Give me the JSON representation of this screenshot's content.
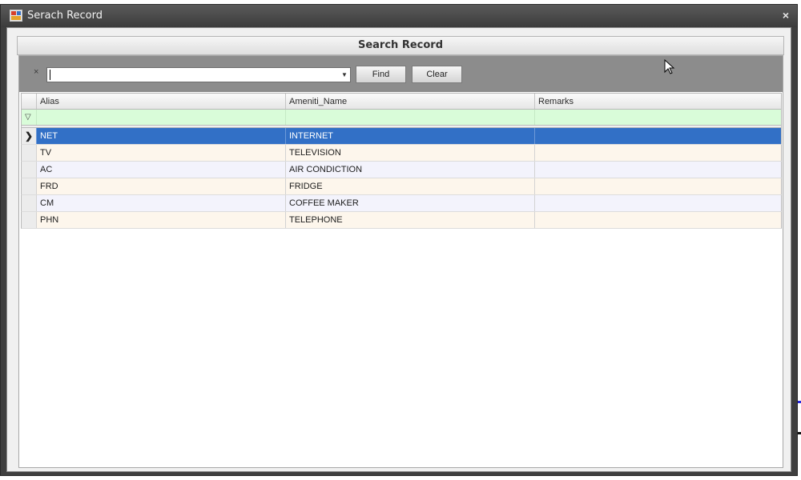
{
  "window": {
    "title": "Serach Record",
    "close_glyph": "×",
    "icon": "form-app-icon"
  },
  "group": {
    "header": "Search Record"
  },
  "find_panel": {
    "clear_glyph": "×",
    "search_value": "",
    "dropdown_glyph": "▼",
    "find_label": "Find",
    "clear_label": "Clear"
  },
  "grid": {
    "columns": [
      "Alias",
      "Ameniti_Name",
      "Remarks"
    ],
    "filter_icon": "▽",
    "row_indicator": "❯",
    "rows": [
      {
        "alias": "NET",
        "name": "INTERNET",
        "remarks": ""
      },
      {
        "alias": "TV",
        "name": "TELEVISION",
        "remarks": ""
      },
      {
        "alias": "AC",
        "name": "AIR CONDICTION",
        "remarks": ""
      },
      {
        "alias": "FRD",
        "name": "FRIDGE",
        "remarks": ""
      },
      {
        "alias": "CM",
        "name": "COFFEE MAKER",
        "remarks": ""
      },
      {
        "alias": "PHN",
        "name": "TELEPHONE",
        "remarks": ""
      }
    ],
    "selected_row": 0
  },
  "colors": {
    "selection": "#3270c6",
    "filter_row": "#d9fcd9",
    "find_panel": "#8c8c8c"
  }
}
